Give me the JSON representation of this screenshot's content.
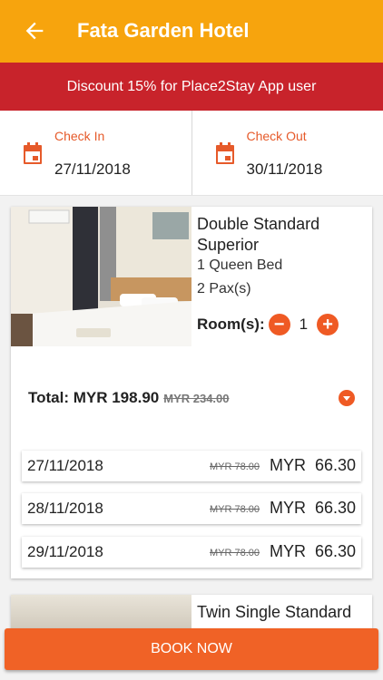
{
  "appbar": {
    "title": "Fata Garden Hotel",
    "back_icon": "arrow-left-icon"
  },
  "promo": {
    "text": "Discount 15% for Place2Stay App user"
  },
  "check_in": {
    "label": "Check In",
    "date": "27/11/2018",
    "icon": "calendar-icon"
  },
  "check_out": {
    "label": "Check Out",
    "date": "30/11/2018",
    "icon": "calendar-icon"
  },
  "room": {
    "name": "Double Standard Superior",
    "bed": "1 Queen Bed",
    "pax": "2 Pax(s)",
    "rooms_label": "Room(s):",
    "quantity": "1",
    "total_label": "Total: MYR 198.90",
    "total_original": "MYR 234.00",
    "nights": [
      {
        "date": "27/11/2018",
        "original": "MYR 78.00",
        "price": "MYR  66.30"
      },
      {
        "date": "28/11/2018",
        "original": "MYR 78.00",
        "price": "MYR  66.30"
      },
      {
        "date": "29/11/2018",
        "original": "MYR 78.00",
        "price": "MYR  66.30"
      }
    ]
  },
  "room2": {
    "name": "Twin Single Standard"
  },
  "book_button": {
    "label": "BOOK NOW"
  },
  "colors": {
    "appbar": "#f7a40d",
    "promo": "#c8232b",
    "accent": "#ef5a24"
  }
}
